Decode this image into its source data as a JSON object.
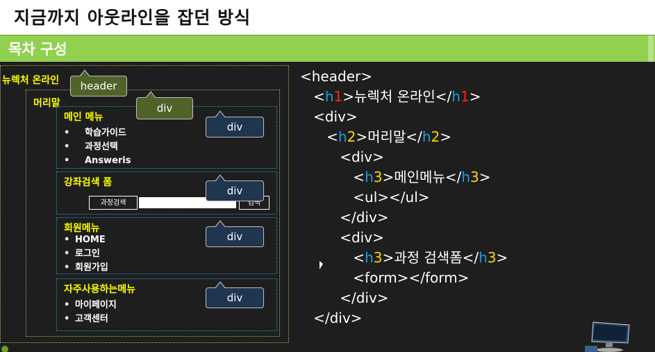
{
  "slide": {
    "title": "지금까지 아웃라인을 잡던 방식",
    "section": "목차 구성"
  },
  "layout_demo": {
    "h1": "뉴렉처 온라인",
    "h2": "머리말",
    "menu": {
      "title": "메인 메뉴",
      "items": [
        "학습가이드",
        "과정선택",
        "Answeris"
      ]
    },
    "search": {
      "title": "강좌검색 폼",
      "label": "과정검색",
      "button": "검색"
    },
    "member": {
      "title": "회원메뉴",
      "items": [
        "HOME",
        "로그인",
        "회원가입"
      ]
    },
    "frequent": {
      "title": "자주사용하는메뉴",
      "items": [
        "마이페이지",
        "고객센터"
      ]
    },
    "callouts": {
      "header": "header",
      "div_head": "div",
      "div_menu": "div",
      "div_search": "div",
      "div_member": "div",
      "div_frequent": "div"
    }
  },
  "code": {
    "l1": "<header>",
    "l2": {
      "a": "<",
      "b": "h1",
      "c": ">뉴렉처 온라인</",
      "d": "h1",
      "e": ">"
    },
    "l3": "<div>",
    "l4": {
      "a": "<",
      "b": "h2",
      "c": ">머리말</",
      "d": "h2",
      "e": ">"
    },
    "l5": "<div>",
    "l6": {
      "a": "<",
      "b": "h3",
      "c": ">메인메뉴</",
      "d": "h3",
      "e": ">"
    },
    "l7": "<ul></ul>",
    "l8": "</div>",
    "l9": "<div>",
    "l10": {
      "a": "<",
      "b": "h3",
      "c": ">과정 검색폼</",
      "d": "h3",
      "e": ">"
    },
    "l11": "<form></form>",
    "l12": "</div>",
    "l13": "</div>"
  },
  "colors": {
    "section_bar": "#92d050",
    "highlight_yellow": "#ffff00",
    "tag_blue": "#1e9ce0",
    "tag_red": "#ff2020"
  },
  "icons": [
    "cursor-icon",
    "monitor-icon",
    "logo-icon"
  ]
}
